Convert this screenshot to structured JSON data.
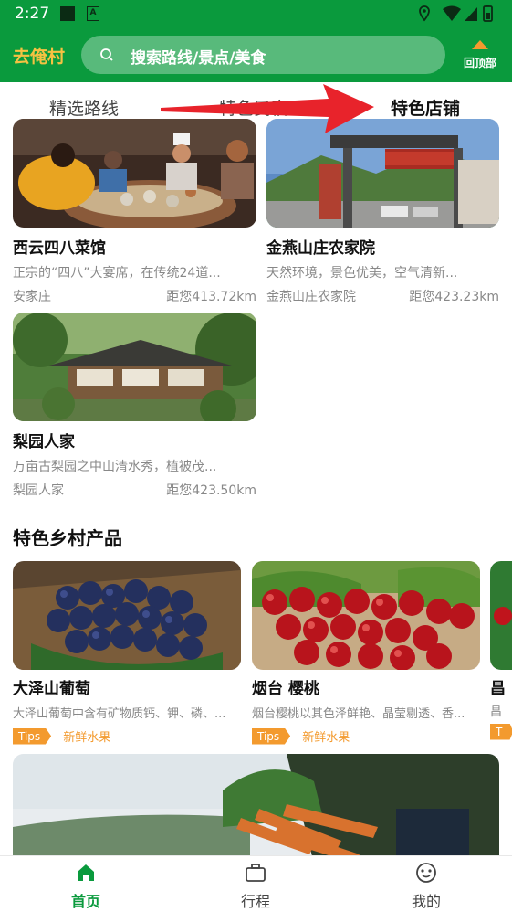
{
  "status_bar": {
    "time": "2:27"
  },
  "header": {
    "brand": "去俺村",
    "search_placeholder": "搜索路线/景点/美食",
    "back_to_top": "回顶部"
  },
  "tabs": [
    {
      "label": "精选路线"
    },
    {
      "label": "特色民宿"
    },
    {
      "label": "特色店铺"
    }
  ],
  "shops": [
    {
      "name": "西云四八菜馆",
      "desc": "正宗的“四八”大宴席，在传统24道...",
      "place": "安家庄",
      "distance": "距您413.72km"
    },
    {
      "name": "金燕山庄农家院",
      "desc": "天然环境，景色优美，空气清新...",
      "place": "金燕山庄农家院",
      "distance": "距您423.23km"
    },
    {
      "name": "梨园人家",
      "desc": "万亩古梨园之中山清水秀，植被茂...",
      "place": "梨园人家",
      "distance": "距您423.50km"
    }
  ],
  "products_section": {
    "title": "特色乡村产品"
  },
  "products": [
    {
      "name": "大泽山葡萄",
      "desc": "大泽山葡萄中含有矿物质钙、钾、磷、...",
      "tip": "Tips",
      "category": "新鲜水果"
    },
    {
      "name": "烟台 樱桃",
      "desc": "烟台樱桃以其色泽鲜艳、晶莹剔透、香...",
      "tip": "Tips",
      "category": "新鲜水果"
    },
    {
      "name": "昌",
      "desc": "昌",
      "tip": "T",
      "category": ""
    }
  ],
  "bottom_nav": [
    {
      "label": "首页",
      "active": true
    },
    {
      "label": "行程",
      "active": false
    },
    {
      "label": "我的",
      "active": false
    }
  ],
  "colors": {
    "brand_green": "#0a9a3d",
    "accent_orange": "#f39a2e",
    "brand_yellow": "#f5c242",
    "arrow_red": "#e8232b"
  }
}
